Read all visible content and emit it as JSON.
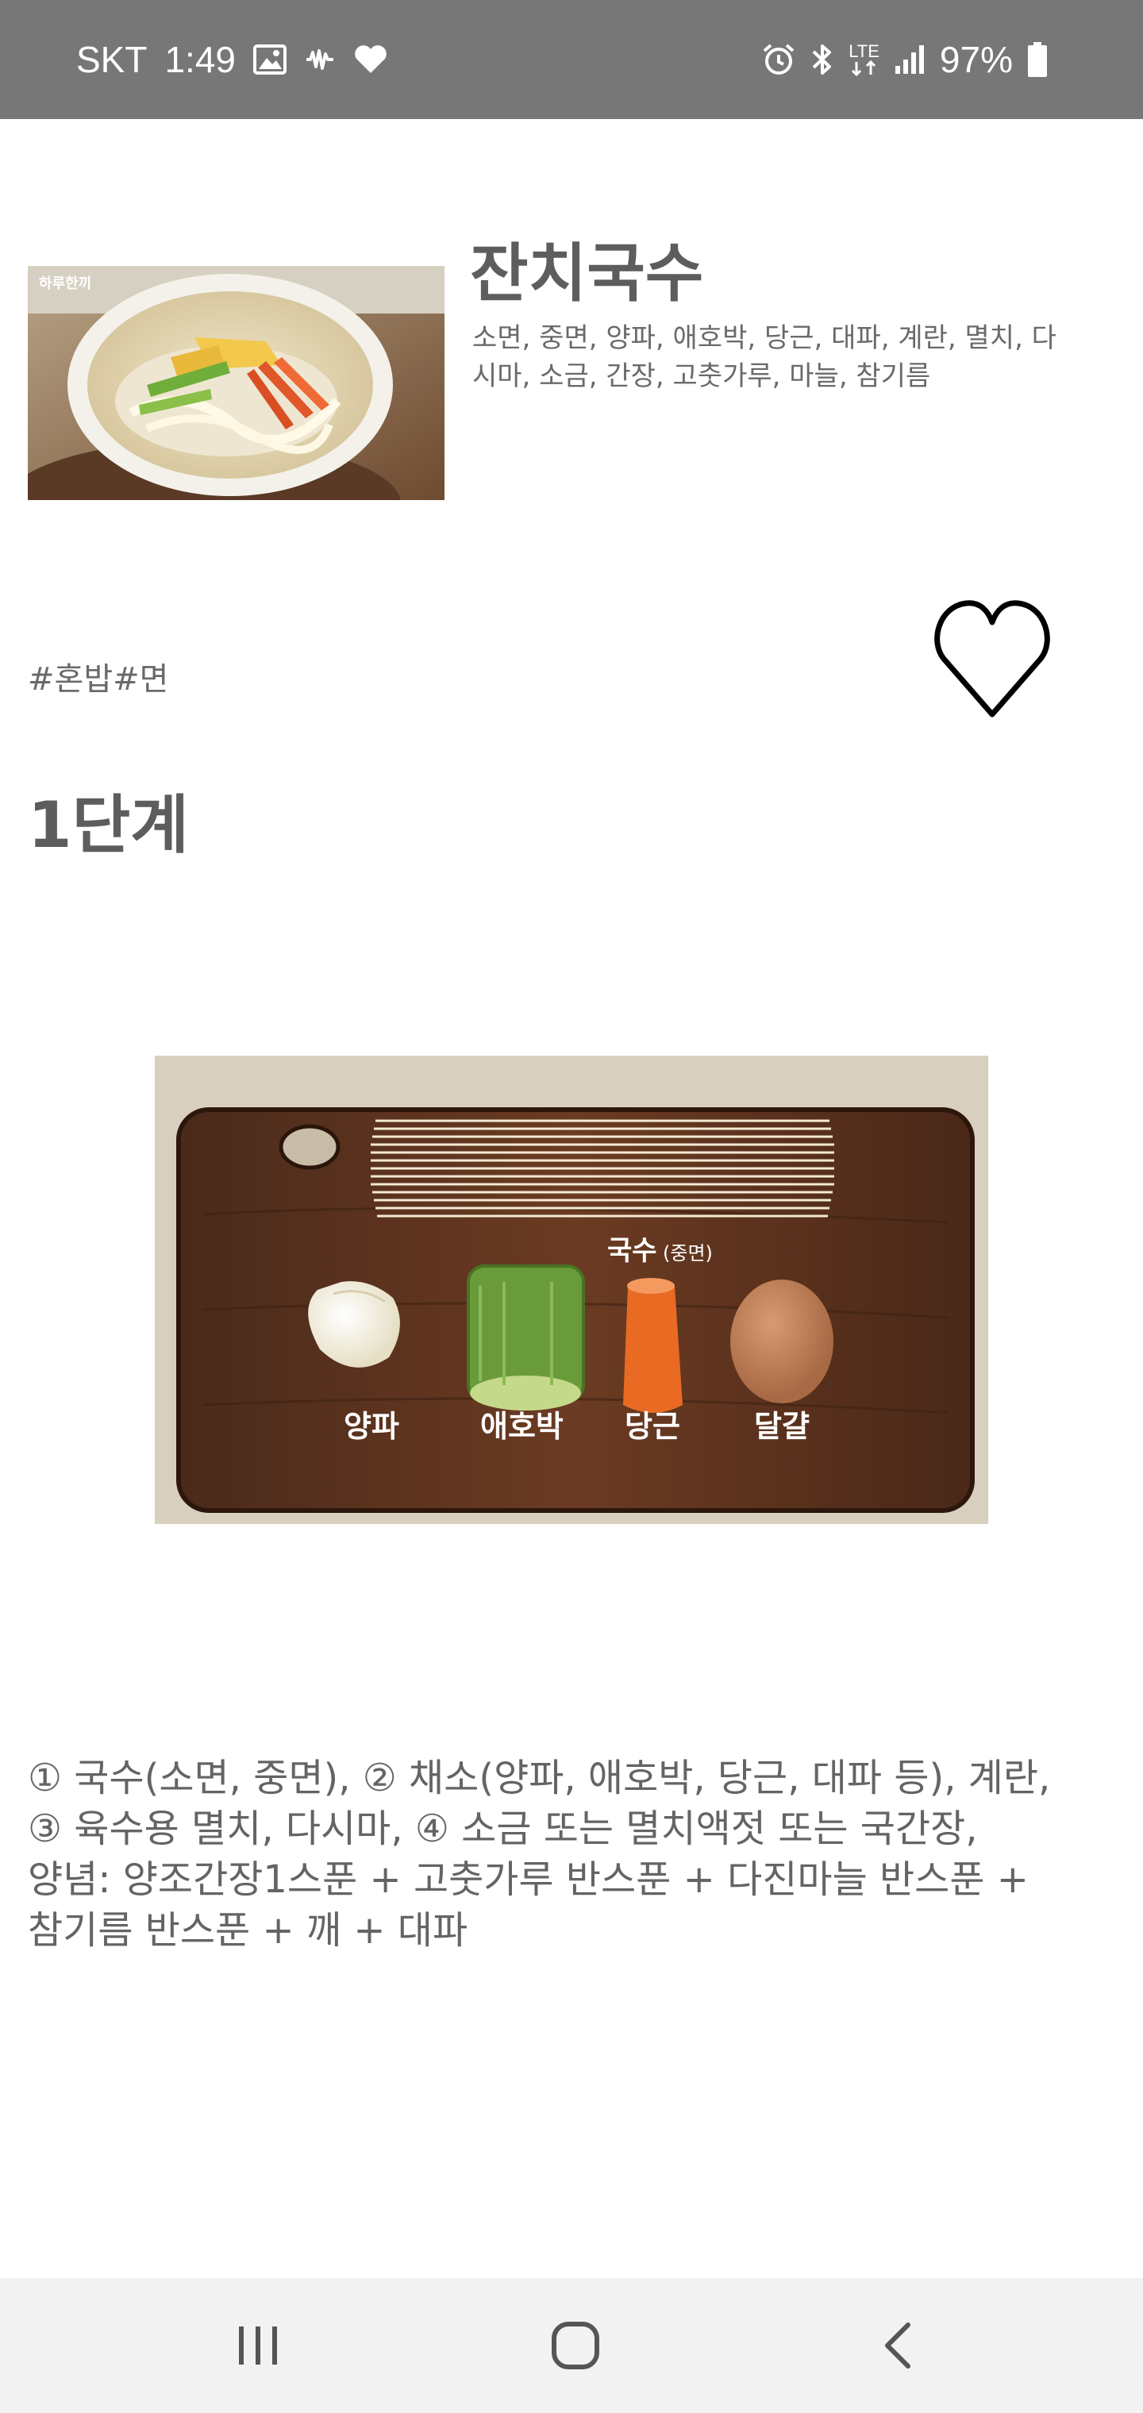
{
  "status_bar": {
    "carrier": "SKT",
    "time": "1:49",
    "network": "LTE",
    "battery": "97%",
    "icons_left": [
      "gallery-icon",
      "voicemail-icon",
      "heart-icon"
    ],
    "icons_right": [
      "alarm-icon",
      "bluetooth-icon",
      "lte-icon",
      "signal-icon",
      "battery-icon"
    ]
  },
  "recipe": {
    "title": "잔치국수",
    "ingredients": "소면, 중면, 양파, 애호박, 당근, 대파, 계란, 멸치, 다시마, 소금, 간장, 고춧가루, 마늘, 참기름",
    "tags": "#혼밥#면",
    "favorite_icon": "heart-outline-icon",
    "thumbnail_watermark": "하루한끼"
  },
  "step": {
    "title": "1단계",
    "image_labels": {
      "noodles": "국수",
      "noodles_type": "(중면)",
      "onion": "양파",
      "zucchini": "애호박",
      "carrot": "당근",
      "egg": "달걀"
    },
    "description": [
      "① 국수(소면, 중면), ② 채소(양파, 애호박, 당근, 대파 등), 계란,",
      "③ 육수용 멸치, 다시마, ④ 소금 또는 멸치액젓 또는 국간장,",
      "양념: 양조간장1스푼 + 고춧가루 반스푼 + 다진마늘 반스푼 +",
      "참기름 반스푼 + 깨 + 대파"
    ]
  },
  "nav_bar": {
    "icons": [
      "recent-apps-icon",
      "home-icon",
      "back-icon"
    ]
  }
}
